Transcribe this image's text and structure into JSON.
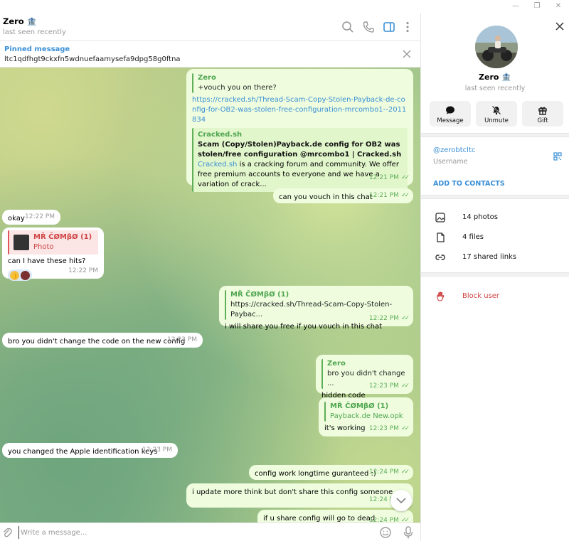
{
  "chat": {
    "title": "Zero 🏦",
    "status": "last seen recently"
  },
  "pinned": {
    "label": "Pinned message",
    "text": "ltc1qdfhgt9ckxfn5wdnuefaamysefa9dpg58g0ftna"
  },
  "messages": {
    "m1": {
      "reply_name": "Zero",
      "reply_text": "+vouch you on there?",
      "link": "https://cracked.sh/Thread-Scam-Copy-Stolen-Payback-de-config-for-OB2-was-stolen-free-configuration-mrcombo1--2011834",
      "preview_site": "Cracked.sh",
      "preview_title": "Scam (Copy/Stolen)Payback.de config for OB2 was stolen/free configuration @mrcombo1 | Cracked.sh",
      "preview_link": "Cracked.sh",
      "preview_desc": " is a cracking forum and community. We offer free premium accounts to everyone and we have a variation of crack...",
      "time": "12:21 PM"
    },
    "m2": {
      "text": "can you vouch in this chat",
      "time": "12:21 PM"
    },
    "m3": {
      "text": "okay",
      "time": "12:22 PM"
    },
    "m4": {
      "reply_name": "MŘ ČØMβØ (1)",
      "reply_text": "Photo",
      "text": "can I have these hits?",
      "reaction": "👍",
      "time": "12:22 PM"
    },
    "m5": {
      "reply_name": "MŘ ČØMβØ (1)",
      "reply_text": "https://cracked.sh/Thread-Scam-Copy-Stolen-Paybac...",
      "text": "i will share you free if you vouch in this chat",
      "time": "12:22 PM"
    },
    "m6": {
      "text": "bro you didn't change the code on the new config",
      "time": "12:23 PM"
    },
    "m7": {
      "reply_name": "Zero",
      "reply_text": "bro you didn't change ...",
      "text": "hidden code",
      "time": "12:23 PM"
    },
    "m8": {
      "reply_name": "MŘ ČØMβØ (1)",
      "reply_text": "Payback.de New.opk",
      "text": "it's working",
      "time": "12:23 PM"
    },
    "m9": {
      "text": "you changed the Apple identification keys",
      "time": "12:23 PM"
    },
    "m10": {
      "text": "config work longtime guranteed :)",
      "time": "12:24 PM"
    },
    "m11": {
      "text": "i update more think but don't share this config someone",
      "time": "12:24 PM"
    },
    "m12": {
      "text": "if u share config will go to dead",
      "time": "12:24 PM"
    }
  },
  "input": {
    "placeholder": "Write a message..."
  },
  "panel": {
    "name": "Zero 🏦",
    "status": "last seen recently",
    "actions": {
      "message": "Message",
      "unmute": "Unmute",
      "gift": "Gift"
    },
    "username": "@zerobtcltc",
    "username_label": "Username",
    "add_contacts": "ADD TO CONTACTS",
    "photos": "14 photos",
    "files": "4 files",
    "links": "17 shared links",
    "block": "Block user"
  },
  "colors": {
    "accent": "#3a8fd6",
    "outgoing_bubble": "#effdde",
    "incoming_bubble": "#ffffff",
    "danger": "#d04545",
    "read_check": "#5fae5a"
  }
}
